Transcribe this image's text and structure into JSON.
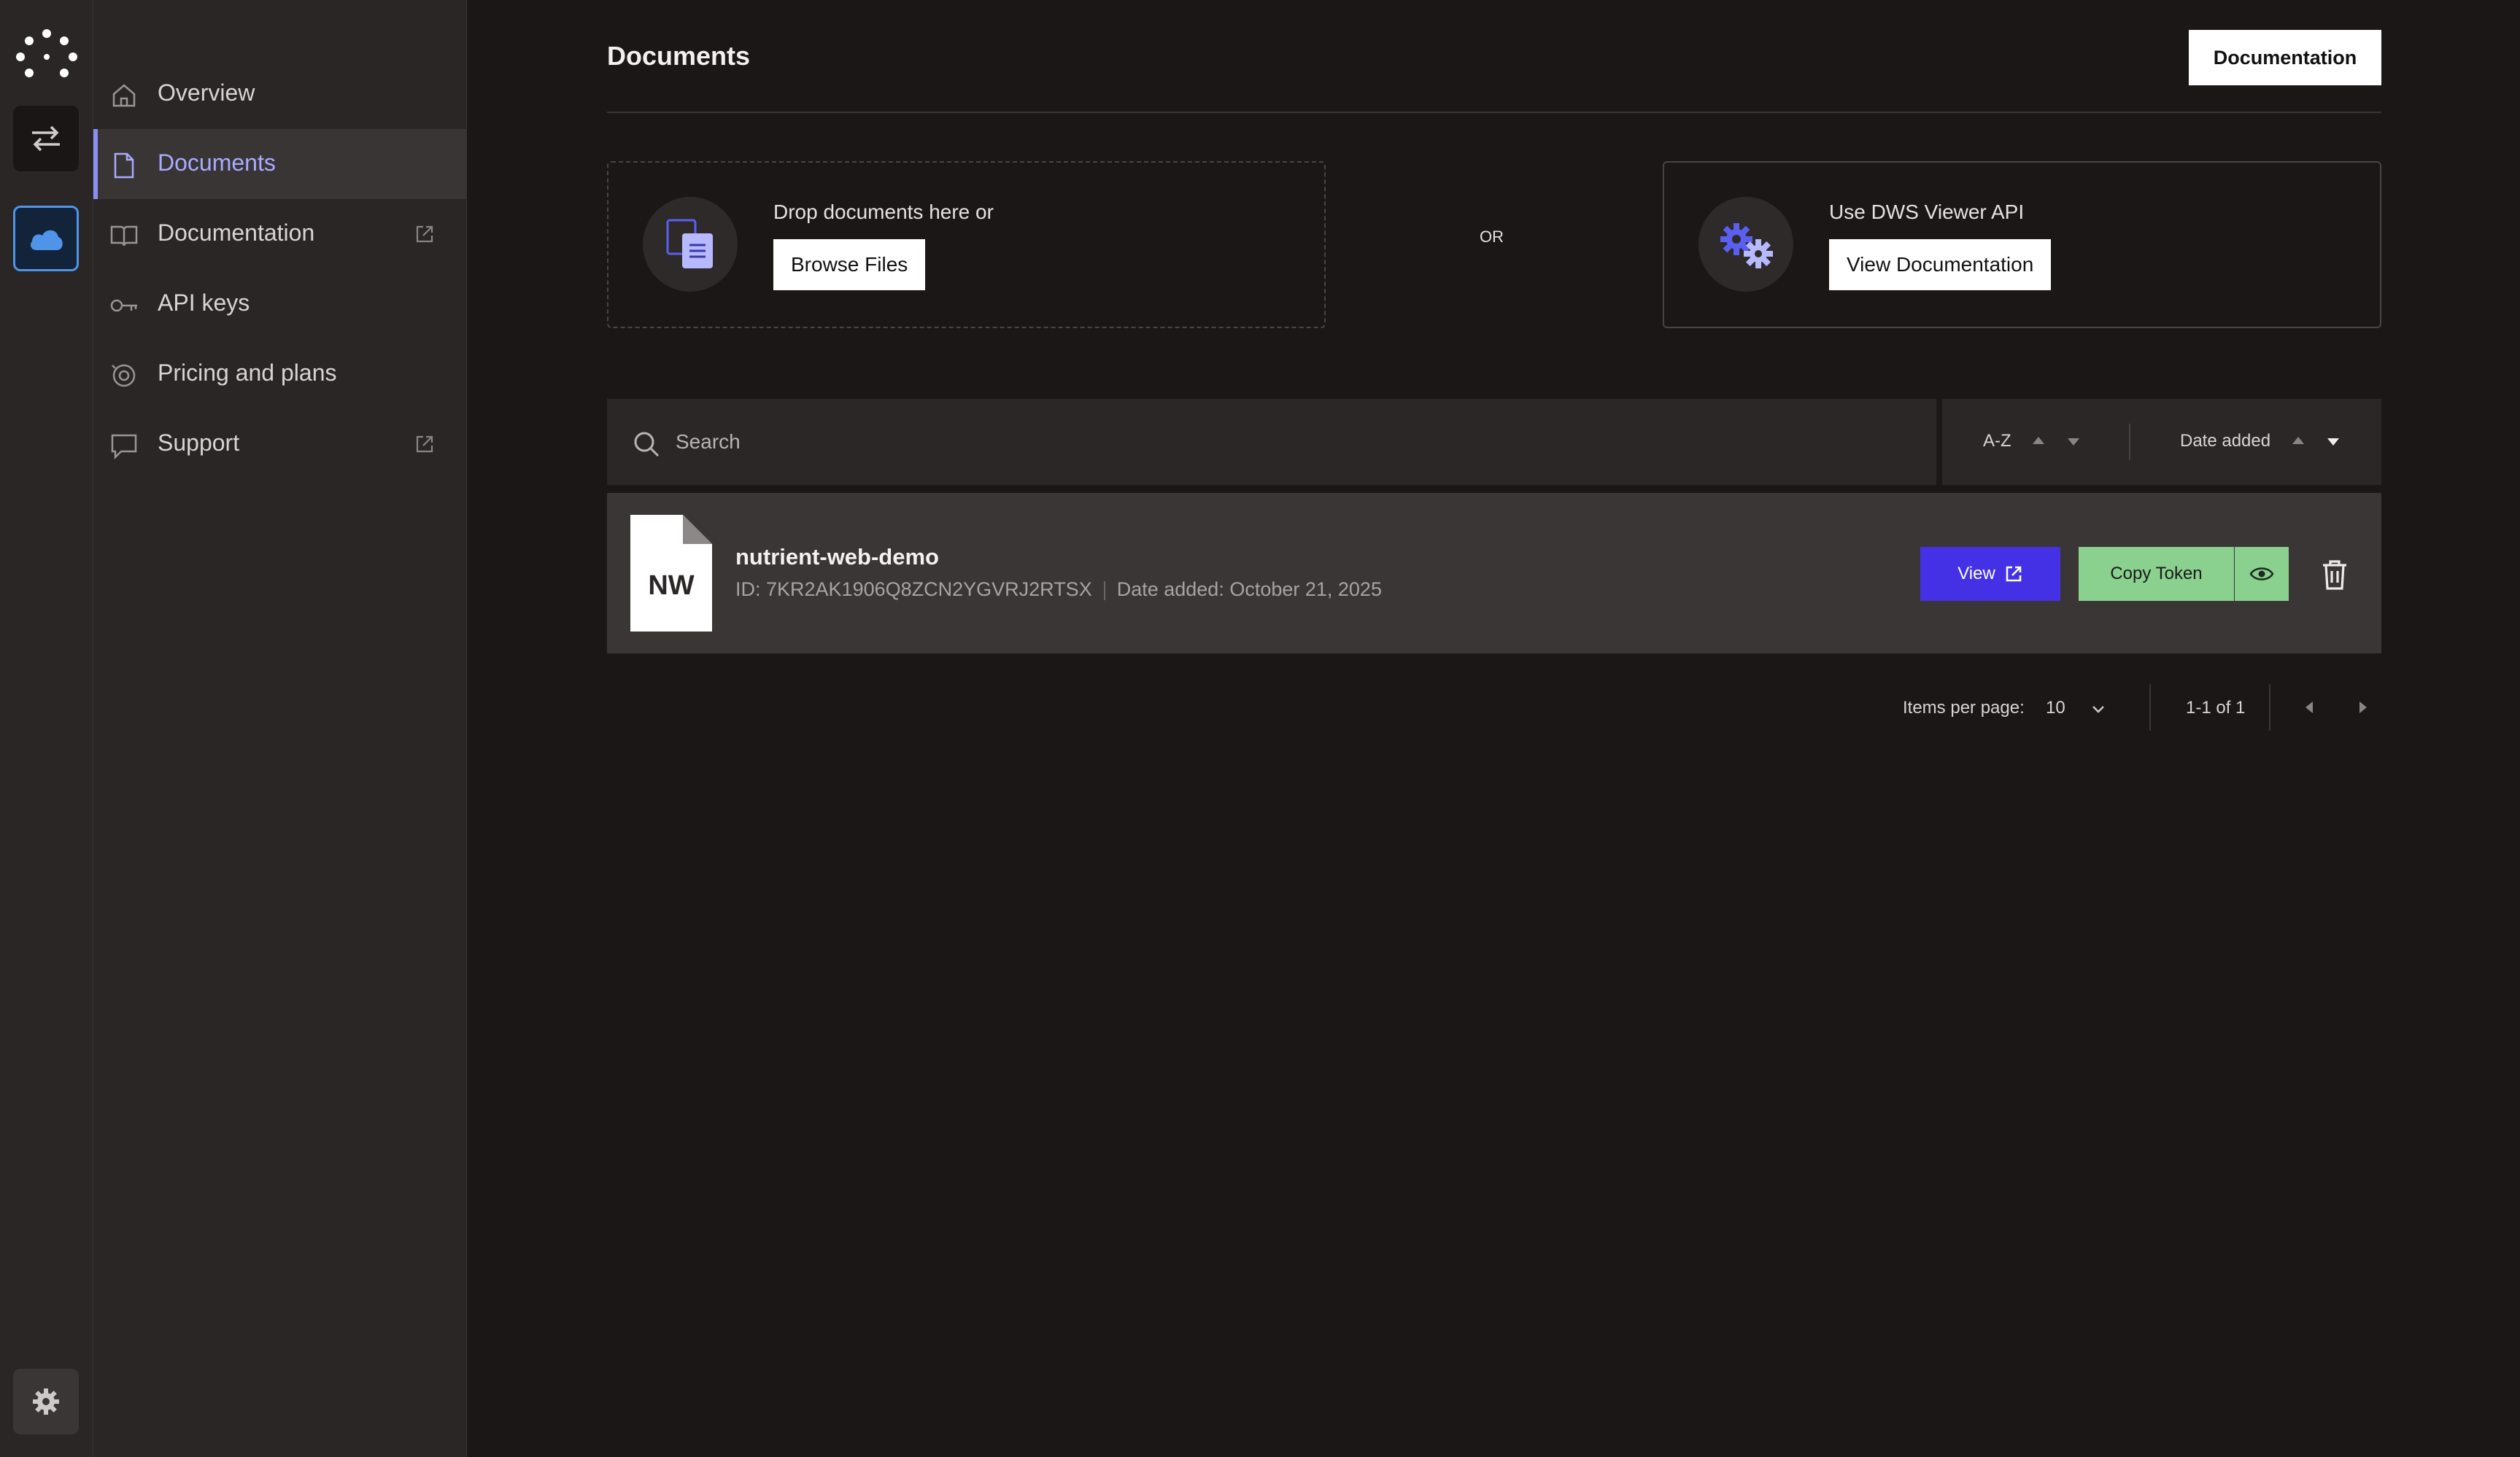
{
  "nav": {
    "items": [
      {
        "label": "Overview",
        "icon": "home-icon"
      },
      {
        "label": "Documents",
        "icon": "document-icon",
        "active": true
      },
      {
        "label": "Documentation",
        "icon": "book-icon",
        "external": true
      },
      {
        "label": "API keys",
        "icon": "key-icon"
      },
      {
        "label": "Pricing and plans",
        "icon": "plans-icon"
      },
      {
        "label": "Support",
        "icon": "chat-icon",
        "external": true
      }
    ]
  },
  "header": {
    "title": "Documents",
    "documentation_button": "Documentation"
  },
  "upload": {
    "drop_text": "Drop documents here or",
    "browse_button": "Browse Files",
    "or_text": "OR",
    "api_text": "Use DWS Viewer API",
    "api_button": "View Documentation"
  },
  "toolbar": {
    "search_placeholder": "Search",
    "sort_az": "A-Z",
    "sort_date": "Date added"
  },
  "documents": [
    {
      "initials": "NW",
      "name": "nutrient-web-demo",
      "id": "ID: 7KR2AK1906Q8ZCN2YGVRJ2RTSX",
      "date": "Date added: October 21, 2025",
      "view_button": "View",
      "copy_button": "Copy Token"
    }
  ],
  "pagination": {
    "items_per_page_label": "Items per page:",
    "items_per_page_value": "10",
    "range": "1-1 of 1"
  },
  "colors": {
    "accent": "#4431e6",
    "active_nav": "#a9abff",
    "copy_token": "#8ad08e",
    "cloud": "#4f94e8"
  }
}
